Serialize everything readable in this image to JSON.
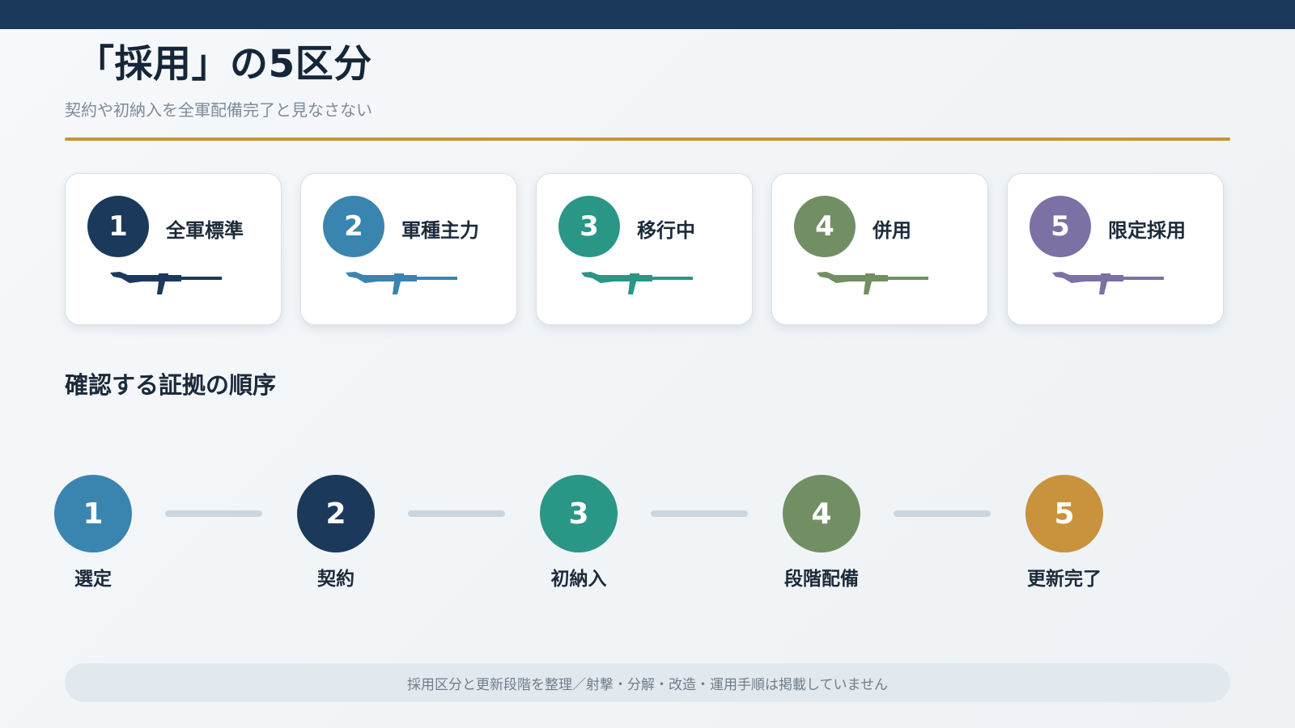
{
  "header": {
    "title": "「採用」の5区分",
    "subtitle": "契約や初納入を全軍配備完了と見なさない"
  },
  "colors": {
    "top_bar": "#1b3a5b",
    "accent_rule": "#c9923c"
  },
  "categories": [
    {
      "number": "1",
      "label": "全軍標準",
      "color": "#1b3a5b",
      "icon": "rifle-icon"
    },
    {
      "number": "2",
      "label": "軍種主力",
      "color": "#3a84b0",
      "icon": "rifle-icon"
    },
    {
      "number": "3",
      "label": "移行中",
      "color": "#2a9686",
      "icon": "rifle-icon"
    },
    {
      "number": "4",
      "label": "併用",
      "color": "#728f64",
      "icon": "rifle-icon"
    },
    {
      "number": "5",
      "label": "限定採用",
      "color": "#7c70a4",
      "icon": "rifle-icon"
    }
  ],
  "evidence": {
    "heading": "確認する証拠の順序",
    "steps": [
      {
        "number": "1",
        "label": "選定",
        "color": "#3a84b0"
      },
      {
        "number": "2",
        "label": "契約",
        "color": "#1b3a5b"
      },
      {
        "number": "3",
        "label": "初納入",
        "color": "#2a9686"
      },
      {
        "number": "4",
        "label": "段階配備",
        "color": "#728f64"
      },
      {
        "number": "5",
        "label": "更新完了",
        "color": "#c9923c"
      }
    ]
  },
  "footer": {
    "note": "採用区分と更新段階を整理／射撃・分解・改造・運用手順は掲載していません"
  }
}
